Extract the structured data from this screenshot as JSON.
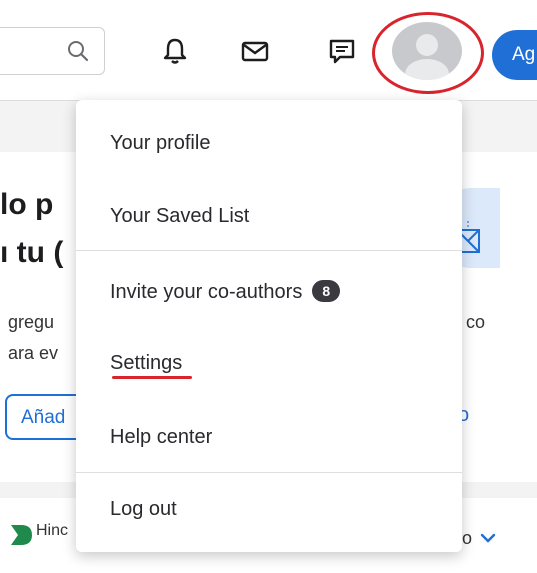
{
  "header": {
    "search": {
      "icon": "search-icon"
    },
    "icons": [
      "bell-icon",
      "mail-icon",
      "chat-icon"
    ],
    "avatar_icon": "avatar",
    "cta_label": "Ag",
    "colors": {
      "highlight": "#d8242c",
      "accent": "#1f6fd6"
    }
  },
  "menu": {
    "items": [
      {
        "label": "Your profile"
      },
      {
        "label": "Your Saved List"
      },
      {
        "label": "Invite your co-authors",
        "badge": "8"
      },
      {
        "label": "Settings"
      },
      {
        "label": "Help center"
      },
      {
        "label": "Log out"
      }
    ]
  },
  "background": {
    "heading_line1": "lo p",
    "heading_line2": "ı tu (",
    "text_line1": "gregu",
    "text_line2": "ara ev",
    "text_right": "co",
    "button_label": "Añad",
    "right_fragment": "o",
    "logo_text": "Hinc",
    "bottom_right": "o"
  }
}
